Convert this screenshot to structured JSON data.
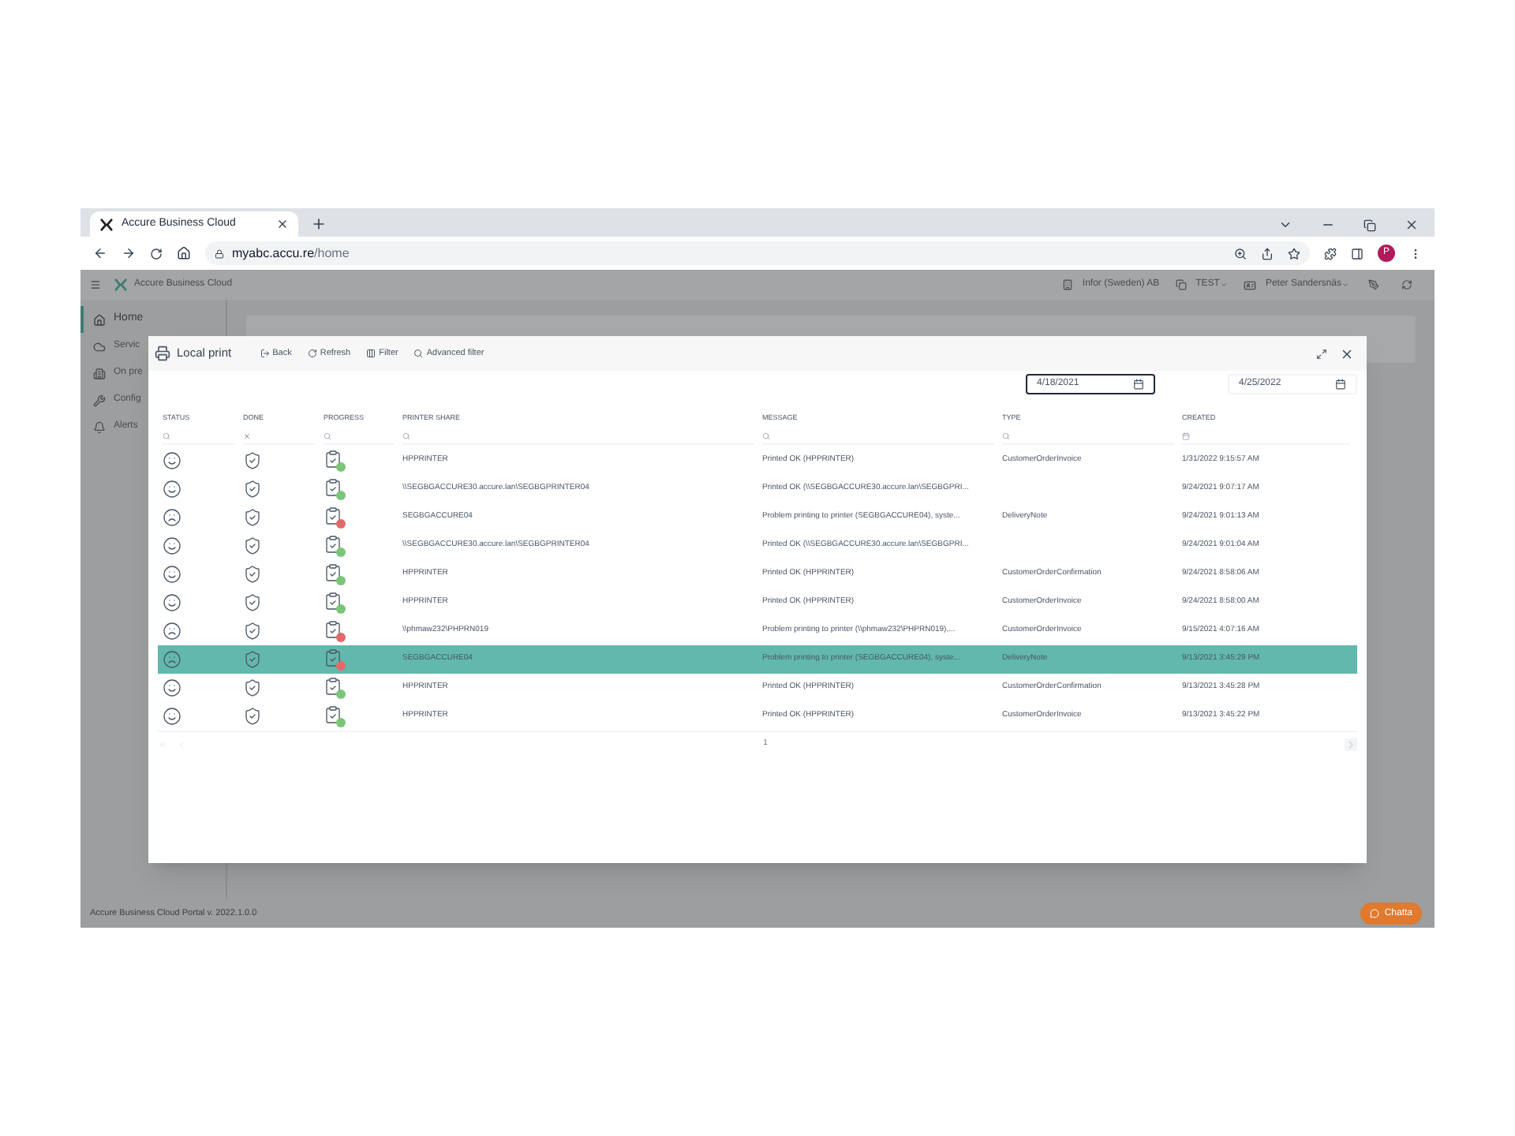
{
  "browser": {
    "tab_title": "Accure Business Cloud",
    "url_host": "myabc.accu.re",
    "url_path": "/home",
    "avatar_letter": "P"
  },
  "app": {
    "brand": "Accure Business Cloud",
    "company": "Infor (Sweden) AB",
    "environment": "TEST",
    "user": "Peter Sandersnäs",
    "sidebar": [
      {
        "label": "Home",
        "selected": true
      },
      {
        "label": "Servic",
        "selected": false
      },
      {
        "label": "On pre",
        "selected": false
      },
      {
        "label": "Config",
        "selected": false
      },
      {
        "label": "Alerts",
        "selected": false
      }
    ],
    "footer": "Accure Business Cloud Portal v. 2022.1.0.0",
    "chat_button": "Chatta"
  },
  "modal": {
    "title": "Local print",
    "toolbar": [
      {
        "label": "Back"
      },
      {
        "label": "Refresh"
      },
      {
        "label": "Filter"
      },
      {
        "label": "Advanced filter"
      }
    ],
    "date_from": {
      "value": "4/18/2021",
      "focused": true
    },
    "date_to": {
      "value": "4/25/2022",
      "focused": false
    },
    "columns": [
      {
        "label": "STATUS",
        "kind": "search"
      },
      {
        "label": "DONE",
        "kind": "clear"
      },
      {
        "label": "PROGRESS",
        "kind": "search"
      },
      {
        "label": "PRINTER SHARE",
        "kind": "search"
      },
      {
        "label": "MESSAGE",
        "kind": "search"
      },
      {
        "label": "TYPE",
        "kind": "search"
      },
      {
        "label": "CREATED",
        "kind": "date"
      }
    ],
    "rows": [
      {
        "kind": "happy",
        "color": "#7cc47a",
        "printer": "HPPRINTER",
        "message": "Printed OK (HPPRINTER)",
        "type": "CustomerOrderInvoice",
        "created": "1/31/2022 9:15:57 AM",
        "selected": false
      },
      {
        "kind": "happy",
        "color": "#7cc47a",
        "printer": "\\\\SEGBGACCURE30.accure.lan\\SEGBGPRINTER04",
        "message": "Printed OK (\\\\SEGBGACCURE30.accure.lan\\SEGBGPRI...",
        "created": "9/24/2021 9:07:17 AM",
        "selected": false
      },
      {
        "kind": "sad",
        "color": "#e06a6a",
        "printer": "SEGBGACCURE04",
        "message": "Problem printing to printer (SEGBGACCURE04), syste...",
        "type": "DeliveryNote",
        "created": "9/24/2021 9:01:13 AM",
        "selected": false
      },
      {
        "kind": "happy",
        "color": "#7cc47a",
        "printer": "\\\\SEGBGACCURE30.accure.lan\\SEGBGPRINTER04",
        "message": "Printed OK (\\\\SEGBGACCURE30.accure.lan\\SEGBGPRI...",
        "created": "9/24/2021 9:01:04 AM",
        "selected": false
      },
      {
        "kind": "happy",
        "color": "#7cc47a",
        "printer": "HPPRINTER",
        "message": "Printed OK (HPPRINTER)",
        "type": "CustomerOrderConfirmation",
        "created": "9/24/2021 8:58:06 AM",
        "selected": false
      },
      {
        "kind": "happy",
        "color": "#7cc47a",
        "printer": "HPPRINTER",
        "message": "Printed OK (HPPRINTER)",
        "type": "CustomerOrderInvoice",
        "created": "9/24/2021 8:58:00 AM",
        "selected": false
      },
      {
        "kind": "sad",
        "color": "#e06a6a",
        "printer": "\\\\phmaw232\\PHPRN019",
        "message": "Problem printing to printer (\\\\phmaw232\\PHPRN019),...",
        "type": "CustomerOrderInvoice",
        "created": "9/15/2021 4:07:16 AM",
        "selected": false
      },
      {
        "kind": "sad",
        "color": "#e06a6a",
        "printer": "SEGBGACCURE04",
        "message": "Problem printing to printer (SEGBGACCURE04), syste...",
        "type": "DeliveryNote",
        "created": "9/13/2021 3:45:29 PM",
        "selected": true
      },
      {
        "kind": "happy",
        "color": "#7cc47a",
        "printer": "HPPRINTER",
        "message": "Printed OK (HPPRINTER)",
        "type": "CustomerOrderConfirmation",
        "created": "9/13/2021 3:45:28 PM",
        "selected": false
      },
      {
        "kind": "happy",
        "color": "#7cc47a",
        "printer": "HPPRINTER",
        "message": "Printed OK (HPPRINTER)",
        "type": "CustomerOrderInvoice",
        "created": "9/13/2021 3:45:22 PM",
        "selected": false
      }
    ],
    "page": "1"
  }
}
